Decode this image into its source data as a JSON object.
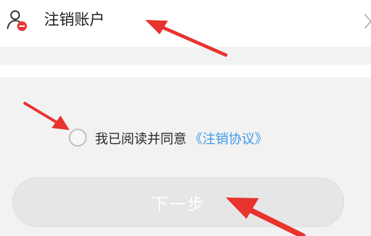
{
  "account_row": {
    "label": "注销账户",
    "icon": "user-icon",
    "chevron": "chevron-right-icon"
  },
  "agreement": {
    "checked": false,
    "text": "我已阅读并同意",
    "link": "《注销协议》"
  },
  "next_button": {
    "label": "下一步",
    "enabled": false
  },
  "colors": {
    "link": "#3c9be8",
    "arrow": "#e8332f",
    "icon_accent": "#e53935",
    "disabled_button": "#e6e6e6"
  }
}
